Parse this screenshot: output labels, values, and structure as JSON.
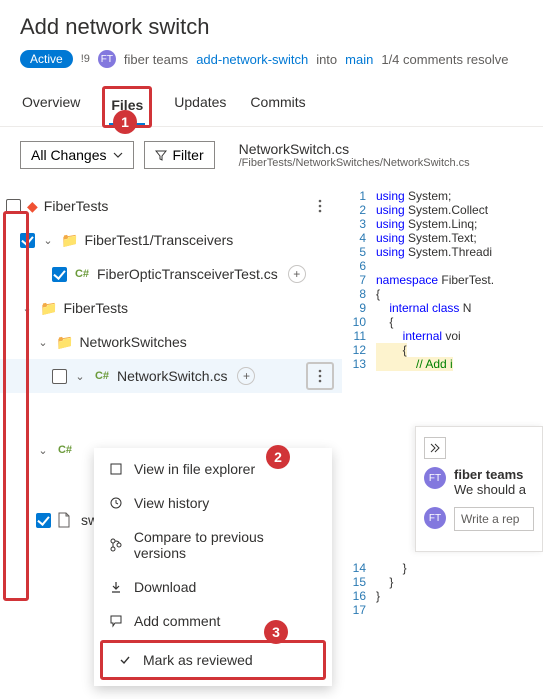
{
  "header": {
    "title": "Add network switch",
    "status": "Active",
    "vote": "!9",
    "avatar": "FT",
    "author": "fiber teams",
    "branch": "add-network-switch",
    "into": "into",
    "target": "main",
    "comments": "1/4 comments resolve"
  },
  "tabs": {
    "overview": "Overview",
    "files": "Files",
    "updates": "Updates",
    "commits": "Commits"
  },
  "toolbar": {
    "all_changes": "All Changes",
    "filter": "Filter",
    "file_name": "NetworkSwitch.cs",
    "file_path": "/FiberTests/NetworkSwitches/NetworkSwitch.cs"
  },
  "tree": {
    "root": "FiberTests",
    "items": [
      "FiberTest1/Transceivers",
      "FiberOpticTransceiverTest.cs",
      "FiberTests",
      "NetworkSwitches",
      "NetworkSwitch.cs",
      "",
      "sw"
    ]
  },
  "menu": {
    "view_explorer": "View in file explorer",
    "view_history": "View history",
    "compare": "Compare to previous versions",
    "download": "Download",
    "add_comment": "Add comment",
    "mark_reviewed": "Mark as reviewed"
  },
  "code": {
    "lines": [
      {
        "n": "1",
        "k": "using",
        "t": " System;"
      },
      {
        "n": "2",
        "k": "using",
        "t": " System.Collect"
      },
      {
        "n": "3",
        "k": "using",
        "t": " System.Linq;"
      },
      {
        "n": "4",
        "k": "using",
        "t": " System.Text;"
      },
      {
        "n": "5",
        "k": "using",
        "t": " System.Threadi"
      },
      {
        "n": "6",
        "k": "",
        "t": ""
      },
      {
        "n": "7",
        "k": "namespace",
        "t": " FiberTest."
      },
      {
        "n": "8",
        "k": "",
        "t": "{"
      },
      {
        "n": "9",
        "k": "    internal class",
        "t": " N"
      },
      {
        "n": "10",
        "k": "",
        "t": "    {"
      },
      {
        "n": "11",
        "k": "        internal",
        "t": " voi"
      },
      {
        "n": "12",
        "k": "",
        "t": "        {",
        "hl": true
      },
      {
        "n": "13",
        "k": "",
        "t": "            // Add i",
        "cm": true,
        "hl": true
      },
      {
        "n": "14",
        "k": "",
        "t": "        }"
      },
      {
        "n": "15",
        "k": "",
        "t": "    }"
      },
      {
        "n": "16",
        "k": "",
        "t": "}"
      },
      {
        "n": "17",
        "k": "",
        "t": ""
      }
    ]
  },
  "panel": {
    "author": "fiber teams",
    "avatar": "FT",
    "text": "We should a",
    "reply_placeholder": "Write a rep"
  },
  "callouts": {
    "c1": "1",
    "c2": "2",
    "c3": "3"
  }
}
